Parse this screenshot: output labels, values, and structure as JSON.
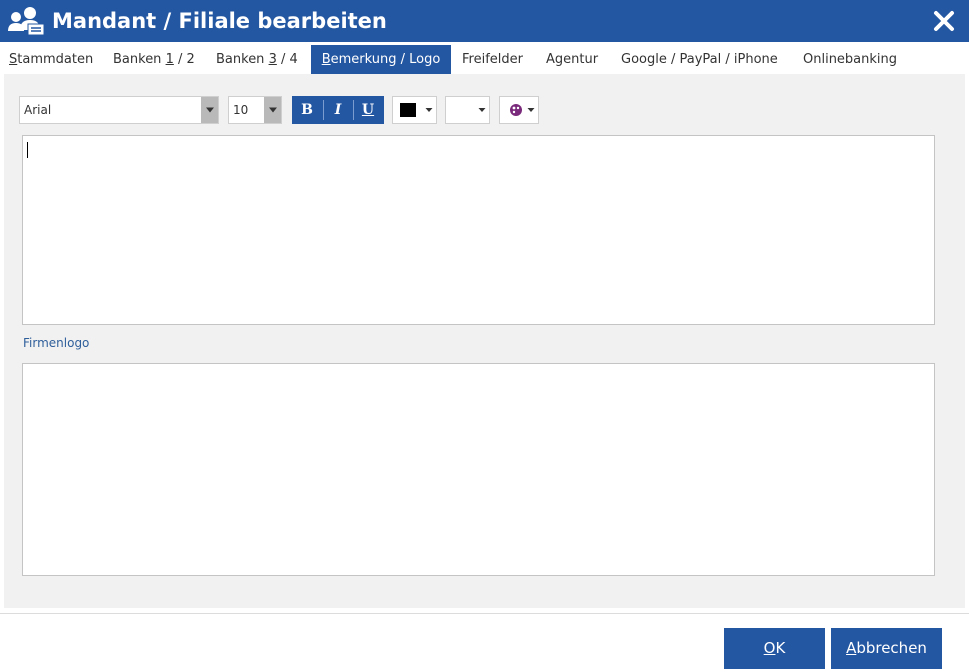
{
  "window": {
    "title": "Mandant / Filiale bearbeiten",
    "icon": "users-icon",
    "close_icon": "close-icon"
  },
  "tabs": [
    {
      "first": "S",
      "rest": "tammdaten",
      "active": false
    },
    {
      "first": "Banken ",
      "under": "1",
      "rest": " / 2",
      "active": false
    },
    {
      "first": "Banken ",
      "under": "3",
      "rest": " / 4",
      "active": false
    },
    {
      "first": "B",
      "rest": "emerkung / Logo",
      "active": true
    },
    {
      "label": "Freifelder",
      "active": false
    },
    {
      "label": "Agentur",
      "active": false
    },
    {
      "label": "Google / PayPal / iPhone",
      "active": false
    },
    {
      "label": "Onlinebanking",
      "active": false
    }
  ],
  "toolbar": {
    "font_value": "Arial",
    "size_value": "10",
    "bold_label": "B",
    "italic_label": "I",
    "underline_label": "U",
    "text_color": "#000000",
    "highlight_color": "",
    "extra_icon": "color-palette-icon"
  },
  "editor": {
    "content": ""
  },
  "logo_section": {
    "label": "Firmenlogo"
  },
  "footer": {
    "ok_first": "O",
    "ok_rest": "K",
    "cancel_first": "A",
    "cancel_rest": "bbrechen"
  },
  "colors": {
    "accent": "#2457a2",
    "panel_bg": "#f1f1f1",
    "label": "#2f5f9b"
  }
}
